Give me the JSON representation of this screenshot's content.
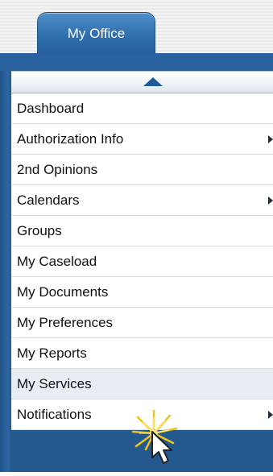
{
  "tab": {
    "label": "My Office"
  },
  "scroll_up": {
    "icon": "triangle-up-icon"
  },
  "menu": {
    "items": [
      {
        "label": "Dashboard",
        "submenu": false
      },
      {
        "label": "Authorization Info",
        "submenu": true
      },
      {
        "label": "2nd Opinions",
        "submenu": false
      },
      {
        "label": "Calendars",
        "submenu": true
      },
      {
        "label": "Groups",
        "submenu": false
      },
      {
        "label": "My Caseload",
        "submenu": false
      },
      {
        "label": "My Documents",
        "submenu": false
      },
      {
        "label": "My Preferences",
        "submenu": false
      },
      {
        "label": "My Reports",
        "submenu": false
      },
      {
        "label": "My Services",
        "submenu": false,
        "hovered": true
      },
      {
        "label": "Notifications",
        "submenu": true
      }
    ]
  },
  "cursor": {
    "icon": "mouse-pointer-icon",
    "effect": "click-burst-icon"
  },
  "colors": {
    "tab_blue": "#2f6fae",
    "frame_blue": "#2a62a0",
    "hover_row": "#e8edf3",
    "burst_yellow": "#f2c21a"
  }
}
